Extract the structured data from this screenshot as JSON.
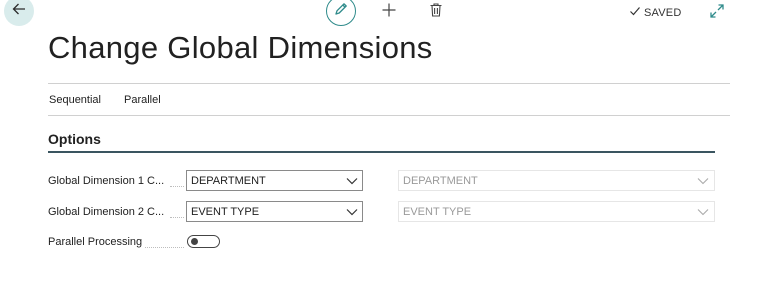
{
  "header": {
    "saved_label": "SAVED"
  },
  "page": {
    "title": "Change Global Dimensions"
  },
  "tabs": [
    {
      "label": "Sequential"
    },
    {
      "label": "Parallel"
    }
  ],
  "options": {
    "section_title": "Options",
    "fields": [
      {
        "label": "Global Dimension 1 C...",
        "value": "DEPARTMENT",
        "readonly_value": "DEPARTMENT"
      },
      {
        "label": "Global Dimension 2 C...",
        "value": "EVENT TYPE",
        "readonly_value": "EVENT TYPE"
      }
    ],
    "parallel_processing": {
      "label": "Parallel Processing",
      "enabled": false
    }
  },
  "colors": {
    "accent": "#2f8b8b",
    "back_button_bg": "#d9ecec",
    "section_rule": "#3a5560"
  },
  "icons": {
    "back": "arrow-left-icon",
    "edit": "pencil-icon",
    "add": "plus-icon",
    "delete": "trash-icon",
    "saved": "checkmark-icon",
    "expand": "expand-icon",
    "dropdown": "chevron-down-icon"
  }
}
